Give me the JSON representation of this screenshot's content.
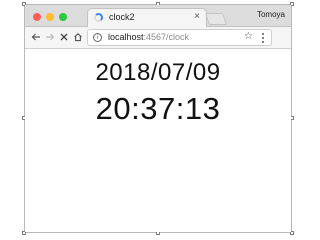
{
  "window": {
    "traffic_lights": {
      "close_color": "#ff5f57",
      "minimize_color": "#febc2e",
      "maximize_color": "#28c840"
    },
    "profile_name": "Tomoya"
  },
  "tab": {
    "title": "clock2",
    "close_glyph": "×",
    "loading_icon": "spinner-icon"
  },
  "toolbar": {
    "back_icon": "arrow-left-icon",
    "forward_icon": "arrow-right-icon",
    "stop_icon": "close-icon",
    "home_icon": "home-icon",
    "address": {
      "host": "localhost",
      "rest": ":4567/clock"
    },
    "info_glyph": "i",
    "star_glyph": "☆",
    "menu_icon": "kebab-menu-icon"
  },
  "clock": {
    "date": "2018/07/09",
    "time": "20:37:13"
  }
}
